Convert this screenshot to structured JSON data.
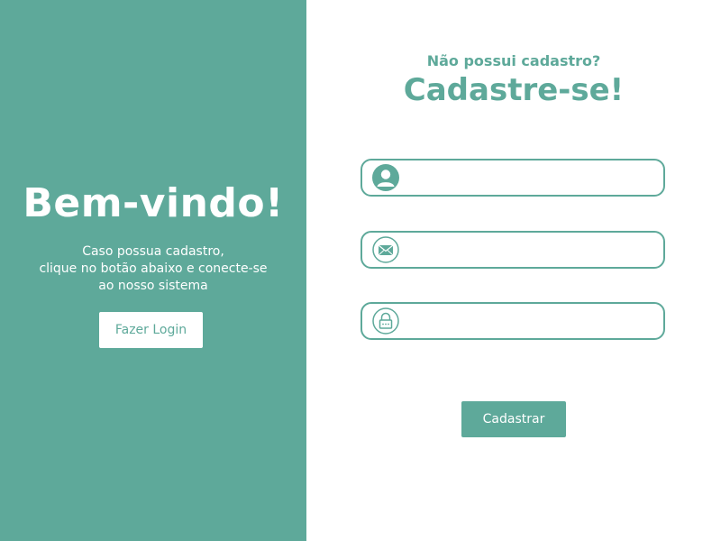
{
  "colors": {
    "accent": "#5ea99a",
    "background": "#ffffff",
    "text_light": "#ffffff"
  },
  "welcome": {
    "title": "Bem-vindo!",
    "text_lines": [
      "Caso possua cadastro,",
      "clique no botão abaixo e conecte-se",
      "ao nosso sistema"
    ],
    "login_button": "Fazer Login"
  },
  "signup": {
    "question": "Não possui cadastro?",
    "title": "Cadastre-se!",
    "fields": [
      {
        "icon": "user-icon",
        "value": "",
        "placeholder": ""
      },
      {
        "icon": "envelope-icon",
        "value": "",
        "placeholder": ""
      },
      {
        "icon": "lock-icon",
        "value": "",
        "placeholder": ""
      }
    ],
    "submit_button": "Cadastrar"
  }
}
